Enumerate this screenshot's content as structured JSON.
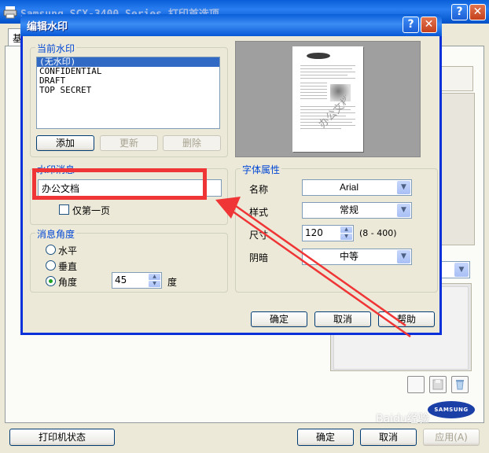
{
  "background_window": {
    "title": "Samsung SCX-3400 Series 打印首选项",
    "tab_label": "基",
    "printer_status_button": "打印机状态",
    "ok_button": "确定",
    "cancel_button": "取消",
    "apply_button": "应用(A)",
    "logo_text": "SAMSUNG"
  },
  "dialog": {
    "title": "编辑水印",
    "help_icon": "help-icon",
    "close_icon": "close-icon",
    "current_watermark": {
      "legend": "当前水印",
      "items": [
        "(无水印)",
        "CONFIDENTIAL",
        "DRAFT",
        "TOP SECRET"
      ],
      "selected_index": 0,
      "add_button": "添加",
      "update_button": "更新",
      "delete_button": "删除"
    },
    "watermark_message": {
      "legend": "水印消息",
      "value": "办公文档",
      "first_page_only": "仅第一页",
      "first_page_only_checked": false
    },
    "message_angle": {
      "legend": "消息角度",
      "horizontal": "水平",
      "vertical": "垂直",
      "angle": "角度",
      "selected": "angle",
      "angle_value": "45",
      "degree_unit": "度"
    },
    "font_attributes": {
      "legend": "字体属性",
      "name_label": "名称",
      "name_value": "Arial",
      "style_label": "样式",
      "style_value": "常规",
      "size_label": "尺寸",
      "size_value": "120",
      "size_range": "(8 - 400)",
      "shade_label": "阴暗",
      "shade_value": "中等"
    },
    "ok_button": "确定",
    "cancel_button": "取消",
    "help_button": "帮助"
  },
  "annotation": {
    "highlight_color": "#ef3535"
  },
  "watermark_overlay": "Baidu经验"
}
